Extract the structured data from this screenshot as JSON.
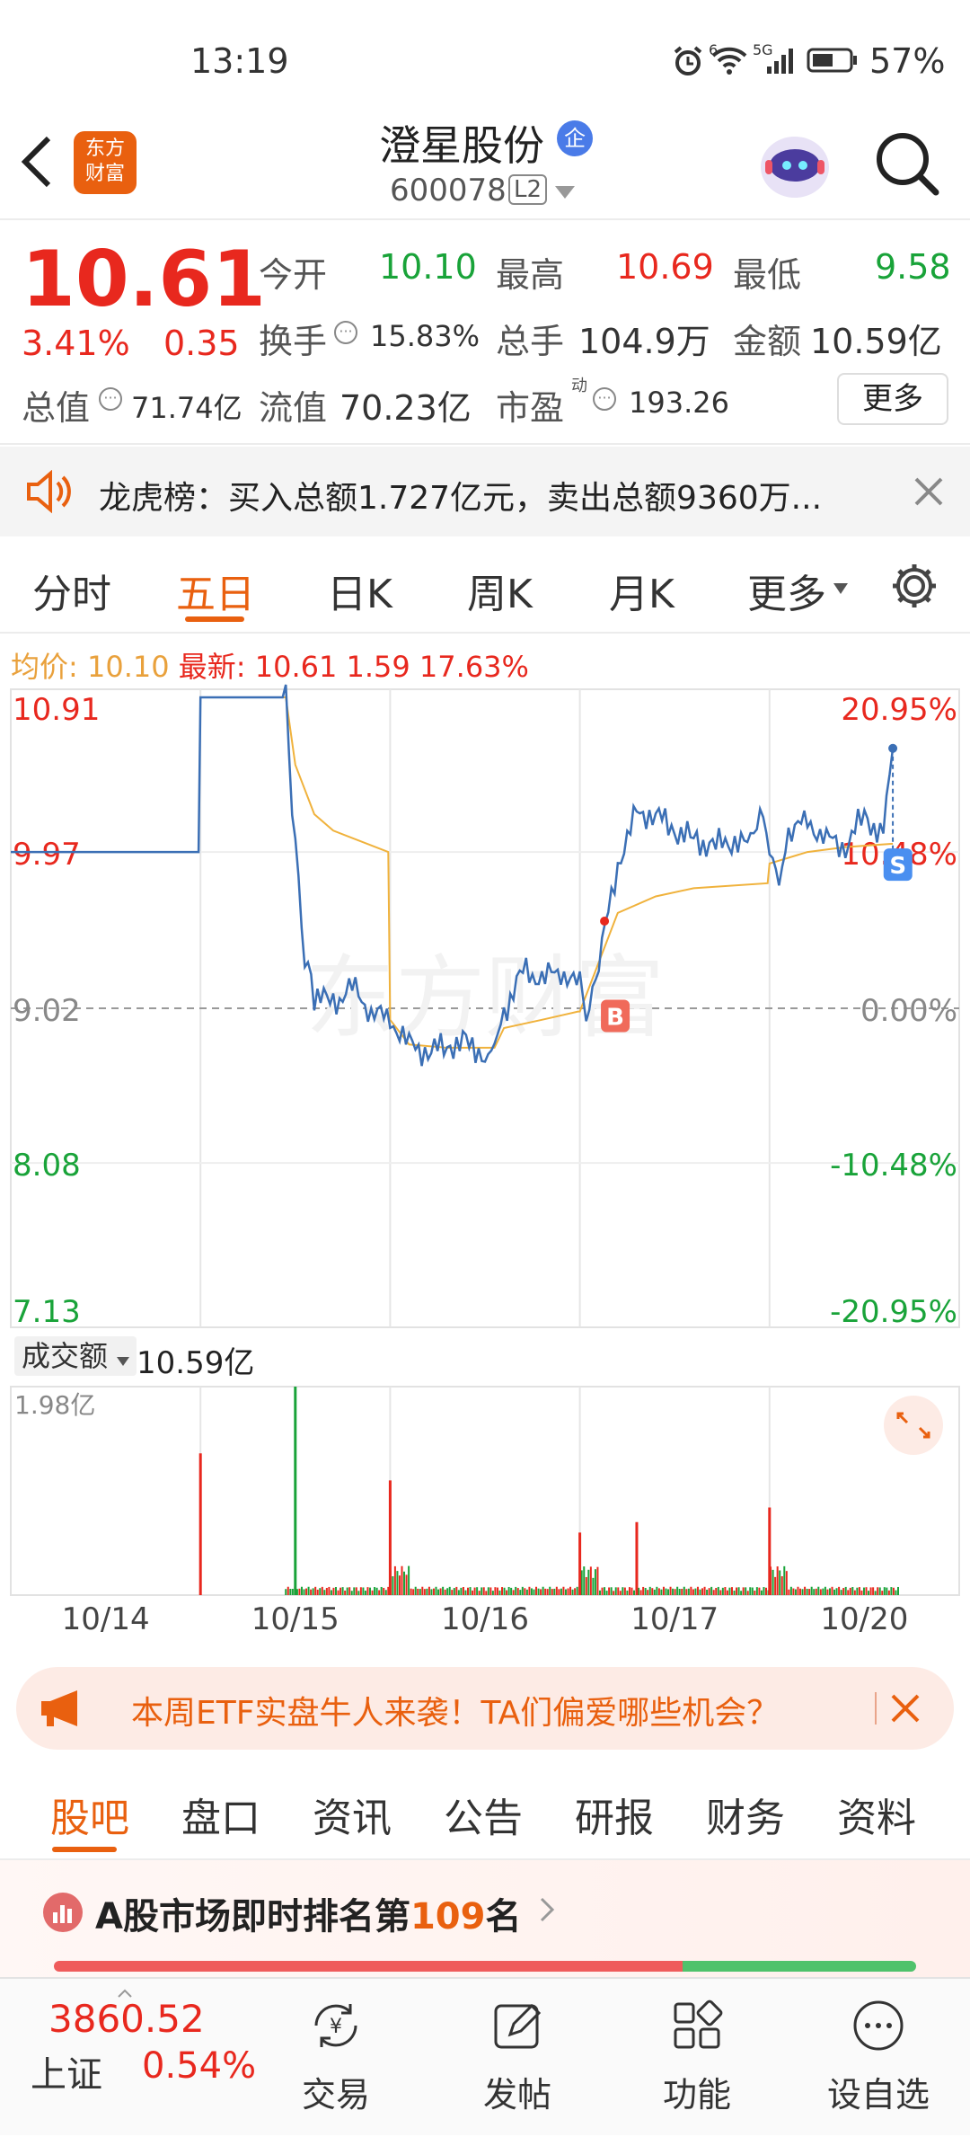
{
  "status": {
    "time": "13:19",
    "battery": "57%",
    "signal_5g": "5G",
    "wifi_6": "6"
  },
  "nav": {
    "stock_name": "澄星股份",
    "qi_badge": "企",
    "code": "600078",
    "level": "L2"
  },
  "quote": {
    "price": "10.61",
    "pct": "3.41%",
    "change": "0.35",
    "open_label": "今开",
    "open": "10.10",
    "high_label": "最高",
    "high": "10.69",
    "low_label": "最低",
    "low": "9.58",
    "turnover_label": "换手",
    "turnover": "15.83%",
    "volume_label": "总手",
    "volume": "104.9万",
    "amount_label": "金额",
    "amount": "10.59亿",
    "mktcap_label": "总值",
    "mktcap": "71.74亿",
    "float_label": "流值",
    "float": "70.23亿",
    "pe_label": "市盈",
    "pe_sup": "动",
    "pe": "193.26",
    "more": "更多"
  },
  "notice": {
    "text": "龙虎榜：买入总额1.727亿元，卖出总额9360万..."
  },
  "tabs": [
    "分时",
    "五日",
    "日K",
    "周K",
    "月K",
    "更多"
  ],
  "active_tab": "五日",
  "chart_info": {
    "avg_label": "均价:",
    "avg": "10.10",
    "latest_label": "最新:",
    "latest": "10.61",
    "diff": "1.59",
    "diff_pct": "17.63%"
  },
  "chart_data": {
    "type": "line",
    "x": [
      "10/14",
      "10/15",
      "10/16",
      "10/17",
      "10/20"
    ],
    "y_ticks_left": [
      "10.91",
      "9.97",
      "9.02",
      "8.08",
      "7.13"
    ],
    "y_ticks_right": [
      "20.95%",
      "10.48%",
      "0.00%",
      "-10.48%",
      "-20.95%"
    ],
    "ylim": [
      7.13,
      10.91
    ],
    "prev_close": 9.02,
    "price_series": [
      [
        0.0,
        9.97
      ],
      [
        0.99,
        9.97
      ],
      [
        1.0,
        10.91
      ],
      [
        1.45,
        10.91
      ],
      [
        1.5,
        9.97
      ],
      [
        1.55,
        9.3
      ],
      [
        1.6,
        9.1
      ],
      [
        1.7,
        9.05
      ],
      [
        1.8,
        9.15
      ],
      [
        1.9,
        9.0
      ],
      [
        2.0,
        8.95
      ],
      [
        2.1,
        8.8
      ],
      [
        2.2,
        8.75
      ],
      [
        2.3,
        8.8
      ],
      [
        2.4,
        8.8
      ],
      [
        2.5,
        8.75
      ],
      [
        2.55,
        8.8
      ],
      [
        2.6,
        9.0
      ],
      [
        2.7,
        9.25
      ],
      [
        2.8,
        9.2
      ],
      [
        2.9,
        9.25
      ],
      [
        3.0,
        9.15
      ],
      [
        3.05,
        8.95
      ],
      [
        3.1,
        9.3
      ],
      [
        3.2,
        9.9
      ],
      [
        3.3,
        10.2
      ],
      [
        3.4,
        10.2
      ],
      [
        3.5,
        10.1
      ],
      [
        3.6,
        10.05
      ],
      [
        3.7,
        10.0
      ],
      [
        3.8,
        10.05
      ],
      [
        3.9,
        10.0
      ],
      [
        3.95,
        10.2
      ],
      [
        4.0,
        10.0
      ],
      [
        4.05,
        9.8
      ],
      [
        4.1,
        10.1
      ],
      [
        4.2,
        10.15
      ],
      [
        4.3,
        10.05
      ],
      [
        4.4,
        10.0
      ],
      [
        4.5,
        10.2
      ],
      [
        4.6,
        10.05
      ],
      [
        4.65,
        10.6
      ]
    ],
    "avg_series": [
      [
        1.0,
        10.91
      ],
      [
        1.45,
        10.91
      ],
      [
        1.5,
        10.5
      ],
      [
        1.6,
        10.2
      ],
      [
        1.7,
        10.1
      ],
      [
        1.99,
        9.97
      ],
      [
        2.0,
        8.95
      ],
      [
        2.1,
        8.8
      ],
      [
        2.3,
        8.78
      ],
      [
        2.55,
        8.78
      ],
      [
        2.6,
        8.9
      ],
      [
        2.8,
        8.95
      ],
      [
        2.99,
        9.0
      ],
      [
        3.0,
        9.0
      ],
      [
        3.1,
        9.3
      ],
      [
        3.2,
        9.6
      ],
      [
        3.4,
        9.7
      ],
      [
        3.6,
        9.75
      ],
      [
        3.99,
        9.78
      ],
      [
        4.0,
        9.9
      ],
      [
        4.2,
        9.97
      ],
      [
        4.4,
        10.0
      ],
      [
        4.65,
        10.02
      ]
    ],
    "volume_label": "成交额",
    "volume_total": "10.59亿",
    "volume_max": "1.98亿",
    "volume_spikes": [
      [
        1.0,
        0.68,
        "r"
      ],
      [
        1.5,
        1.0,
        "g"
      ],
      [
        2.0,
        0.55,
        "r"
      ],
      [
        3.0,
        0.3,
        "r"
      ],
      [
        3.3,
        0.35,
        "r"
      ],
      [
        4.0,
        0.42,
        "r"
      ]
    ],
    "markers": [
      {
        "label": "B",
        "x": 3.13,
        "y": 9.05
      },
      {
        "label": "S",
        "x": 4.62,
        "y": 9.97
      }
    ]
  },
  "banner": {
    "text": "本周ETF实盘牛人来袭！TA们偏爱哪些机会？"
  },
  "subtabs": [
    "股吧",
    "盘口",
    "资讯",
    "公告",
    "研报",
    "财务",
    "资料"
  ],
  "active_subtab": "股吧",
  "rank": {
    "prefix": "A股市场即时排名第",
    "num": "109",
    "suffix": "名"
  },
  "bottom": {
    "index_value": "3860.52",
    "index_name": "上证",
    "index_pct": "0.54%",
    "items": [
      "交易",
      "发帖",
      "功能",
      "设自选"
    ]
  },
  "colors": {
    "up": "#e8281e",
    "down": "#19a339",
    "accent": "#e9600f",
    "line": "#3b6fb5",
    "avg": "#f0b23c"
  }
}
